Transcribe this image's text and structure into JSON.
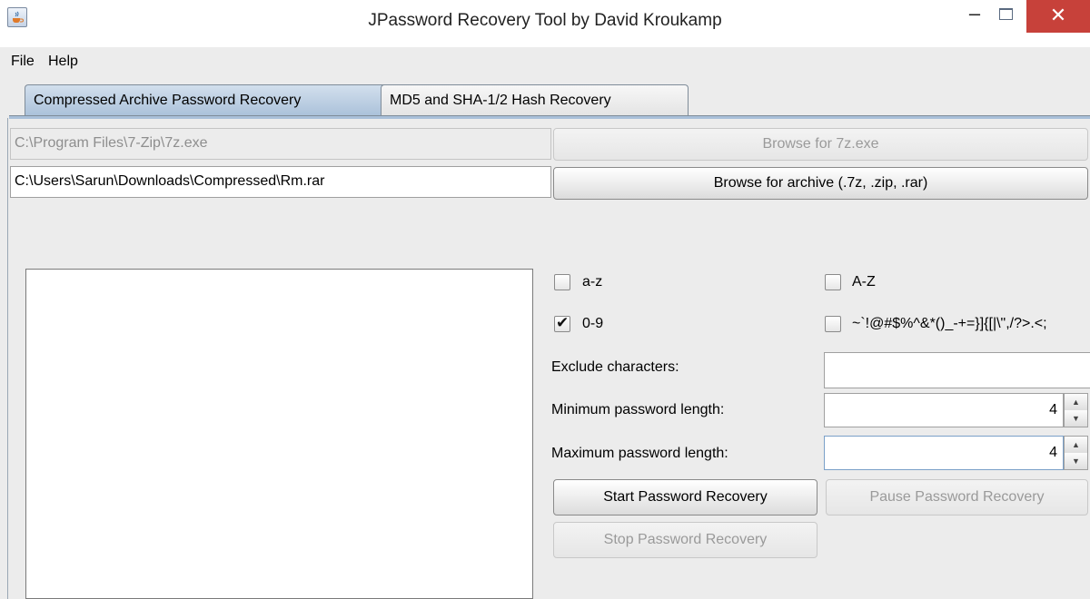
{
  "window": {
    "title": "JPassword Recovery Tool by David Kroukamp",
    "minimize_glyph": "–",
    "close_glyph": "✕"
  },
  "menu": {
    "items": [
      "File",
      "Help"
    ]
  },
  "tabs": [
    {
      "label": "Compressed Archive Password Recovery",
      "selected": true
    },
    {
      "label": "MD5 and SHA-1/2 Hash Recovery",
      "selected": false
    }
  ],
  "fields": {
    "seven_zip_path": "C:\\Program Files\\7-Zip\\7z.exe",
    "archive_path": "C:\\Users\\Sarun\\Downloads\\Compressed\\Rm.rar"
  },
  "buttons": {
    "browse_7z": "Browse for 7z.exe",
    "browse_archive": "Browse for archive (.7z, .zip, .rar)",
    "start": "Start Password Recovery",
    "pause": "Pause Password Recovery",
    "stop": "Stop Password Recovery"
  },
  "charsets": [
    {
      "label": "a-z",
      "checked": false
    },
    {
      "label": "A-Z",
      "checked": false
    },
    {
      "label": "0-9",
      "checked": true
    },
    {
      "label": "~`!@#$%^&*()_-+=}]{[|\\\",/?>.<;",
      "checked": false
    }
  ],
  "labels": {
    "exclude": "Exclude characters:",
    "min_length": "Minimum password length:",
    "max_length": "Maximum password length:"
  },
  "values": {
    "exclude": "",
    "min_length": "4",
    "max_length": "4"
  },
  "icons": {
    "app": "java-cup-icon",
    "spin_up": "▲",
    "spin_down": "▼",
    "check": "✔"
  },
  "colors": {
    "close_button": "#c7413a",
    "selected_tab": "#a9c0d9",
    "window_bg": "#ececec"
  }
}
